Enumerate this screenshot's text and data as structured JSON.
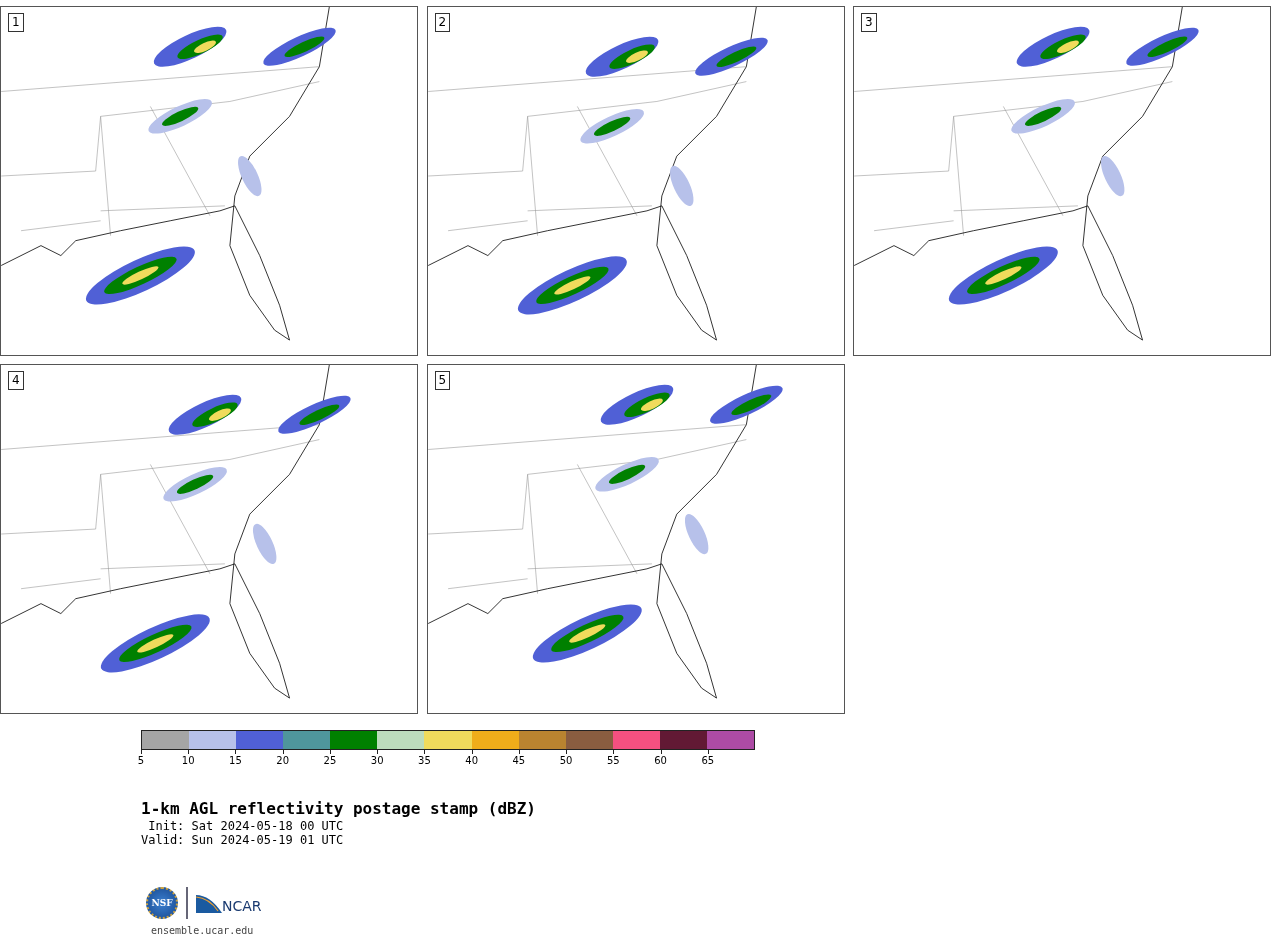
{
  "panels": [
    {
      "number": "1"
    },
    {
      "number": "2"
    },
    {
      "number": "3"
    },
    {
      "number": "4"
    },
    {
      "number": "5"
    }
  ],
  "colorbar": [
    {
      "label": "5",
      "color": "#a5a5a5"
    },
    {
      "label": "10",
      "color": "#b7c1ea"
    },
    {
      "label": "15",
      "color": "#5060d6"
    },
    {
      "label": "20",
      "color": "#4f969c"
    },
    {
      "label": "25",
      "color": "#008000"
    },
    {
      "label": "30",
      "color": "#bcdcbc"
    },
    {
      "label": "35",
      "color": "#f0db5c"
    },
    {
      "label": "40",
      "color": "#f0ad1a"
    },
    {
      "label": "45",
      "color": "#b98430"
    },
    {
      "label": "50",
      "color": "#895d40"
    },
    {
      "label": "55",
      "color": "#f55080"
    },
    {
      "label": "60",
      "color": "#621934"
    },
    {
      "label": "65",
      "color": "#ad4ba5"
    }
  ],
  "title": "1-km AGL reflectivity postage stamp (dBZ)",
  "init": " Init: Sat 2024-05-18 00 UTC",
  "valid": "Valid: Sun 2024-05-19 01 UTC",
  "logos": {
    "nsf": "NSF",
    "ncar": "NCAR"
  },
  "footer": "ensemble.ucar.edu"
}
